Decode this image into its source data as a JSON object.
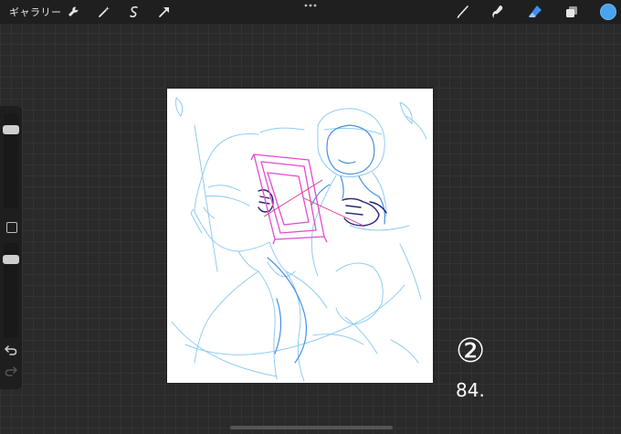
{
  "topbar": {
    "gallery_label": "ギャラリー",
    "left_tools": [
      "wrench-icon",
      "magic-wand-icon",
      "selection-icon",
      "transform-arrow-icon"
    ],
    "right_tools": [
      "brush-icon",
      "smudge-icon",
      "eraser-icon",
      "layers-icon"
    ],
    "active_tool": "eraser-icon",
    "current_color": "#4aa3f0"
  },
  "sidebar": {
    "brush_size_level": 0.9,
    "opacity_level": 0.9
  },
  "note": {
    "number": "②",
    "text": "84."
  }
}
